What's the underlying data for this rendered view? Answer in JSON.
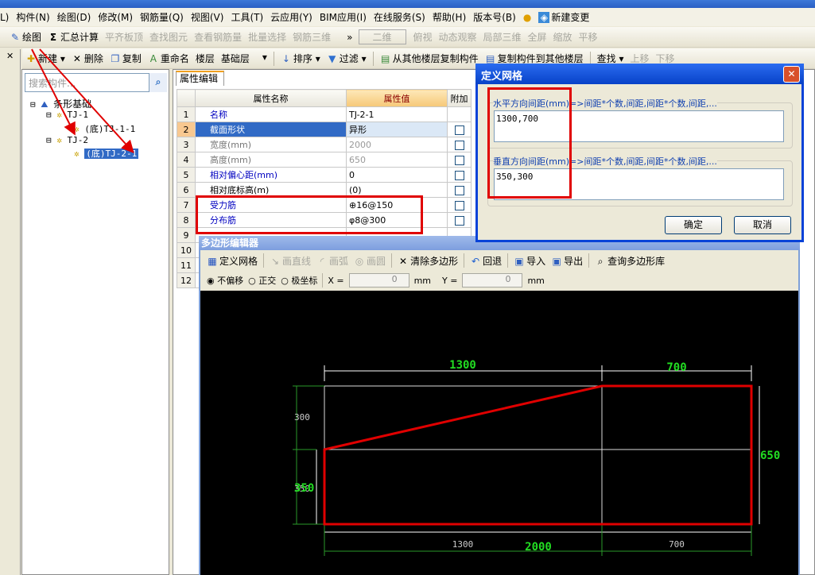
{
  "menu": [
    "L)",
    "构件(N)",
    "绘图(D)",
    "修改(M)",
    "钢筋量(Q)",
    "视图(V)",
    "工具(T)",
    "云应用(Y)",
    "BIM应用(I)",
    "在线服务(S)",
    "帮助(H)",
    "版本号(B)",
    "新建变更"
  ],
  "toolbar1": {
    "draw": "绘图",
    "sum": "汇总计算",
    "align": "平齐板顶",
    "find": "查找图元",
    "view_rebar": "查看钢筋量",
    "batch": "批量选择",
    "rebar3d": "钢筋三维",
    "view_mode": "二维",
    "top_view": "俯视",
    "orbit": "动态观察",
    "local3d": "局部三维",
    "fullscreen": "全屏",
    "zoom": "缩放",
    "pan": "平移"
  },
  "toolbar2": {
    "new": "新建",
    "delete": "删除",
    "copy": "复制",
    "rename": "重命名",
    "floor_label": "楼层",
    "floor_value": "基础层",
    "sort": "排序",
    "filter": "过滤",
    "copy_from": "从其他楼层复制构件",
    "copy_to": "复制构件到其他楼层",
    "find": "查找",
    "up": "上移",
    "down": "下移"
  },
  "tree": {
    "search_placeholder": "搜索构件...",
    "root": "条形基础",
    "items": [
      {
        "label": "TJ-1"
      },
      {
        "label": "(底)TJ-1-1"
      },
      {
        "label": "TJ-2"
      },
      {
        "label": "(底)TJ-2-1"
      }
    ]
  },
  "props": {
    "tab": "属性编辑",
    "headers": [
      "属性名称",
      "属性值",
      "附加"
    ],
    "rows": [
      {
        "n": "1",
        "name": "名称",
        "value": "TJ-2-1"
      },
      {
        "n": "2",
        "name": "截面形状",
        "value": "异形"
      },
      {
        "n": "3",
        "name": "宽度(mm)",
        "value": "2000"
      },
      {
        "n": "4",
        "name": "高度(mm)",
        "value": "650"
      },
      {
        "n": "5",
        "name": "相对偏心距(mm)",
        "value": "0"
      },
      {
        "n": "6",
        "name": "相对底标高(m)",
        "value": "(0)"
      },
      {
        "n": "7",
        "name": "受力筋",
        "value": "⊕16@150"
      },
      {
        "n": "8",
        "name": "分布筋",
        "value": "φ8@300"
      },
      {
        "n": "9",
        "name": "",
        "value": ""
      },
      {
        "n": "10",
        "name": "",
        "value": ""
      },
      {
        "n": "11",
        "name": "",
        "value": ""
      },
      {
        "n": "12",
        "name": "",
        "value": ""
      }
    ]
  },
  "editor": {
    "title": "多边形编辑器",
    "toolbar": {
      "grid": "定义网格",
      "line": "画直线",
      "arc": "画弧",
      "circle": "画圆",
      "clear": "清除多边形",
      "undo": "回退",
      "import": "导入",
      "export": "导出",
      "library": "查询多边形库"
    },
    "modes": [
      "不偏移",
      "正交",
      "极坐标"
    ],
    "selected_mode": "不偏移",
    "x_label": "X =",
    "x_value": "0",
    "y_label": "Y =",
    "y_value": "0",
    "unit": "mm",
    "dims": {
      "top_left": "1300",
      "top_right": "700",
      "right": "650",
      "left_top": "300",
      "left_bottom": "350",
      "left_total": "350",
      "bottom_left": "1300",
      "bottom_right": "700",
      "bottom_total": "2000"
    }
  },
  "dialog": {
    "title": "定义网格",
    "h_label": "水平方向间距(mm)=>间距*个数,间距,间距*个数,间距,...",
    "h_value": "1300,700",
    "v_label": "垂直方向间距(mm)=>间距*个数,间距,间距*个数,间距,...",
    "v_value": "350,300",
    "ok": "确定",
    "cancel": "取消"
  },
  "colors": {
    "polygon": "#e00000",
    "dim_green": "#22dd22",
    "annotation": "#e00000"
  }
}
